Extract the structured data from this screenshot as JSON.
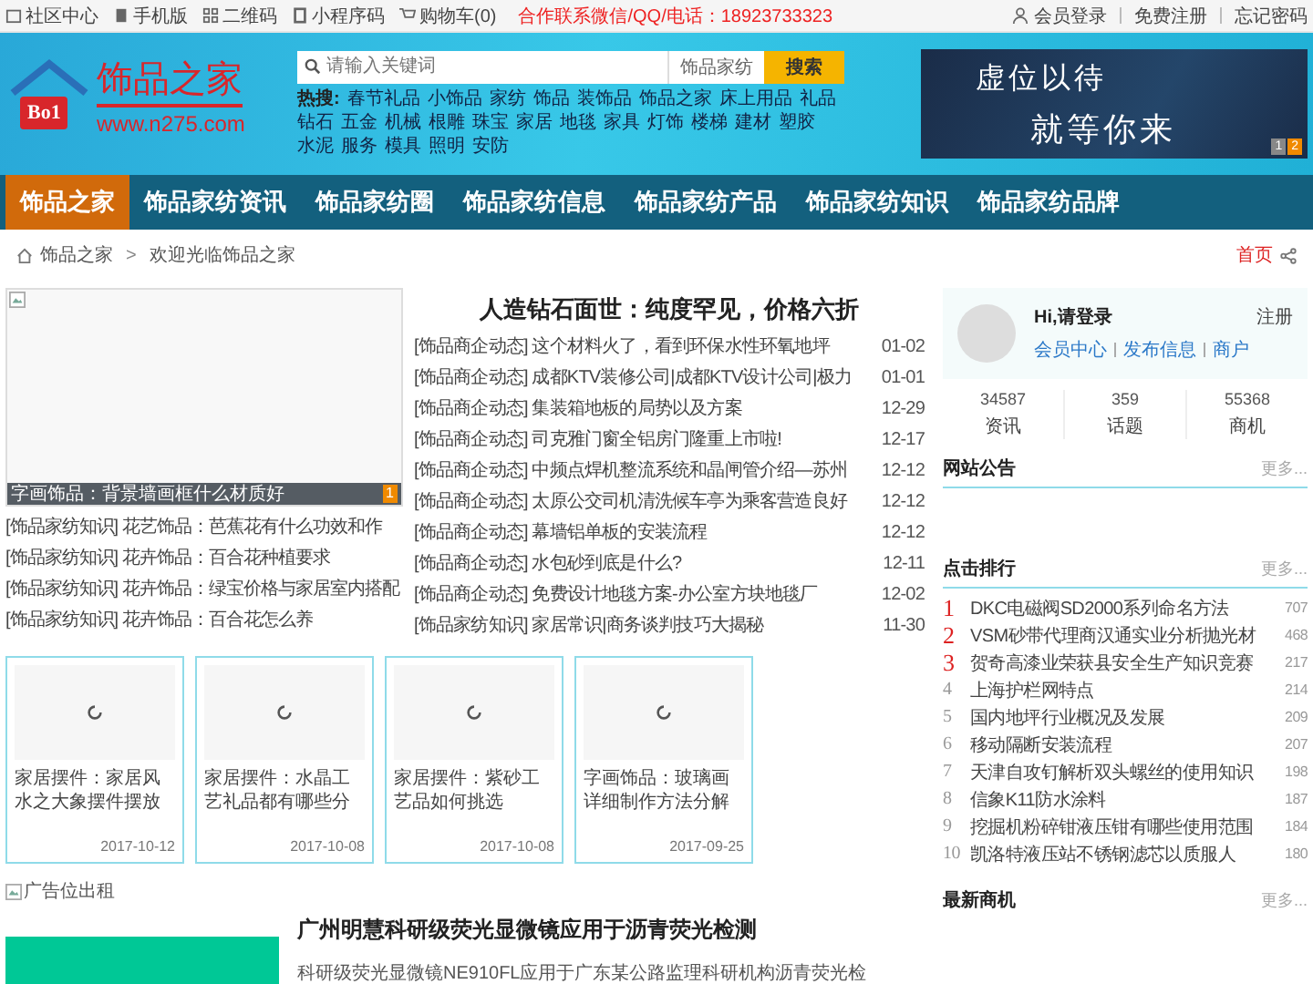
{
  "top_bar": {
    "links": [
      "社区中心",
      "手机版",
      "二维码",
      "小程序码",
      "购物车(0)"
    ],
    "contact": "合作联系微信/QQ/电话：18923733323",
    "account_links": [
      "会员登录",
      "免费注册",
      "忘记密码"
    ]
  },
  "header": {
    "logo": {
      "badge": "Bo1",
      "name": "饰品之家",
      "url": "www.n275.com"
    },
    "search": {
      "placeholder": "请输入关键词",
      "category": "饰品家纺",
      "button": "搜索"
    },
    "hot": {
      "label": "热搜:",
      "words": [
        "春节礼品",
        "小饰品",
        "家纺",
        "饰品",
        "装饰品",
        "饰品之家",
        "床上用品",
        "礼品",
        "钻石",
        "五金",
        "机械",
        "根雕",
        "珠宝",
        "家居",
        "地毯",
        "家具",
        "灯饰",
        "楼梯",
        "建材",
        "塑胶",
        "水泥",
        "服务",
        "模具",
        "照明",
        "安防"
      ]
    },
    "banner": {
      "lines": [
        "虚位以待",
        "就等你来"
      ],
      "pages": [
        {
          "label": "1",
          "selected": false
        },
        {
          "label": "2",
          "selected": true
        }
      ]
    }
  },
  "nav": [
    {
      "label": "饰品之家",
      "selected": true
    },
    {
      "label": "饰品家纺资讯",
      "selected": false
    },
    {
      "label": "饰品家纺圈",
      "selected": false
    },
    {
      "label": "饰品家纺信息",
      "selected": false
    },
    {
      "label": "饰品家纺产品",
      "selected": false
    },
    {
      "label": "饰品家纺知识",
      "selected": false
    },
    {
      "label": "饰品家纺品牌",
      "selected": false
    }
  ],
  "breadcrumb": {
    "items": [
      "饰品之家",
      "欢迎光临饰品之家"
    ],
    "separator": ">",
    "home_link": "首页"
  },
  "feature": {
    "caption": "字画饰品：背景墙画框什么材质好",
    "badge": "1"
  },
  "knowledge_list": [
    {
      "category": "[饰品家纺知识]",
      "title": "花艺饰品：芭蕉花有什么功效和作"
    },
    {
      "category": "[饰品家纺知识]",
      "title": "花卉饰品：百合花种植要求"
    },
    {
      "category": "[饰品家纺知识]",
      "title": "花卉饰品：绿宝价格与家居室内搭配"
    },
    {
      "category": "[饰品家纺知识]",
      "title": "花卉饰品：百合花怎么养"
    }
  ],
  "headline": "人造钻石面世：纯度罕见，价格六折",
  "news": [
    {
      "category": "[饰品商企动态]",
      "title": "这个材料火了，看到环保水性环氧地坪",
      "date": "01-02"
    },
    {
      "category": "[饰品商企动态]",
      "title": "成都KTV装修公司|成都KTV设计公司|极力",
      "date": "01-01"
    },
    {
      "category": "[饰品商企动态]",
      "title": "集装箱地板的局势以及方案",
      "date": "12-29"
    },
    {
      "category": "[饰品商企动态]",
      "title": "司克雅门窗全铝房门隆重上市啦!",
      "date": "12-17"
    },
    {
      "category": "[饰品商企动态]",
      "title": "中频点焊机整流系统和晶闸管介绍—苏州",
      "date": "12-12"
    },
    {
      "category": "[饰品商企动态]",
      "title": "太原公交司机清洗候车亭为乘客营造良好",
      "date": "12-12"
    },
    {
      "category": "[饰品商企动态]",
      "title": "幕墙铝单板的安装流程",
      "date": "12-12"
    },
    {
      "category": "[饰品商企动态]",
      "title": "水包砂到底是什么?",
      "date": "12-11"
    },
    {
      "category": "[饰品商企动态]",
      "title": "免费设计地毯方案-办公室方块地毯厂",
      "date": "12-02"
    },
    {
      "category": "[饰品家纺知识]",
      "title": "家居常识|商务谈判技巧大揭秘",
      "date": "11-30"
    }
  ],
  "cards": [
    {
      "title": "家居摆件：家居风水之大象摆件摆放",
      "date": "2017-10-12"
    },
    {
      "title": "家居摆件：水晶工艺礼品都有哪些分",
      "date": "2017-10-08"
    },
    {
      "title": "家居摆件：紫砂工艺品如何挑选",
      "date": "2017-10-08"
    },
    {
      "title": "字画饰品：玻璃画详细制作方法分解",
      "date": "2017-09-25"
    }
  ],
  "ad_alt": "广告位出租",
  "article": {
    "title": "广州明慧科研级荧光显微镜应用于沥青荧光检测",
    "snippet": "科研级荧光显微镜NE910FL应用于广东某公路监理科研机构沥青荧光检"
  },
  "sidebar": {
    "login": {
      "greeting": "Hi,请登录",
      "register": "注册",
      "links": [
        "会员中心",
        "发布信息",
        "商户"
      ]
    },
    "stats": [
      {
        "value": "34587",
        "label": "资讯"
      },
      {
        "value": "359",
        "label": "话题"
      },
      {
        "value": "55368",
        "label": "商机"
      }
    ],
    "notice": {
      "title": "网站公告",
      "more": "更多..."
    },
    "ranking": {
      "title": "点击排行",
      "more": "更多...",
      "items": [
        {
          "rank": "1",
          "title": "DKC电磁阀SD2000系列命名方法",
          "count": "707"
        },
        {
          "rank": "2",
          "title": "VSM砂带代理商汉通实业分析抛光材",
          "count": "468"
        },
        {
          "rank": "3",
          "title": "贺奇高漆业荣获县安全生产知识竞赛",
          "count": "217"
        },
        {
          "rank": "4",
          "title": "上海护栏网特点",
          "count": "214"
        },
        {
          "rank": "5",
          "title": "国内地坪行业概况及发展",
          "count": "209"
        },
        {
          "rank": "6",
          "title": "移动隔断安装流程",
          "count": "207"
        },
        {
          "rank": "7",
          "title": "天津自攻钉解析双头螺丝的使用知识",
          "count": "198"
        },
        {
          "rank": "8",
          "title": "信象K11防水涂料",
          "count": "187"
        },
        {
          "rank": "9",
          "title": "挖掘机粉碎钳液压钳有哪些使用范围",
          "count": "184"
        },
        {
          "rank": "10",
          "title": "凯洛特液压站不锈钢滤芯以质服人",
          "count": "180"
        }
      ]
    },
    "latest": {
      "title": "最新商机",
      "more": "更多..."
    }
  }
}
